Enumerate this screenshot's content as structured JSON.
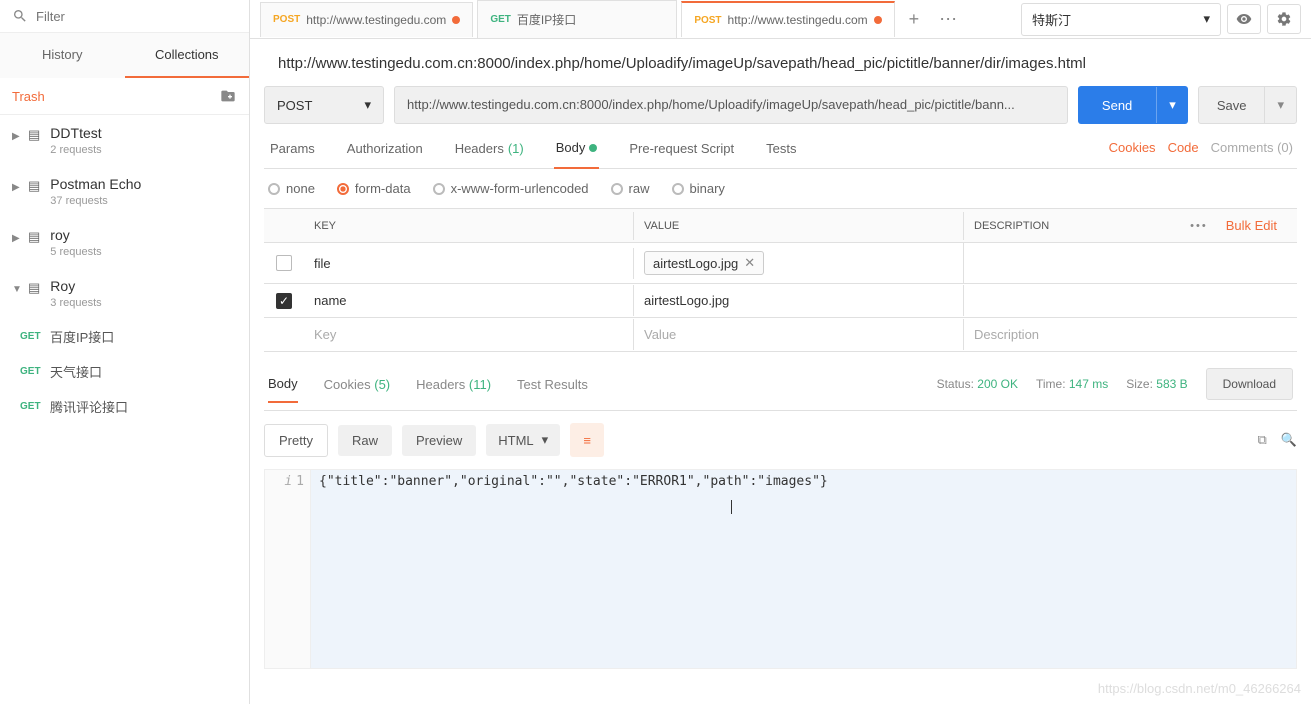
{
  "sidebar": {
    "filter_placeholder": "Filter",
    "tabs": {
      "history": "History",
      "collections": "Collections"
    },
    "trash": "Trash",
    "collections": [
      {
        "name": "DDTtest",
        "sub": "2 requests"
      },
      {
        "name": "Postman Echo",
        "sub": "37 requests"
      },
      {
        "name": "roy",
        "sub": "5 requests"
      },
      {
        "name": "Roy",
        "sub": "3 requests"
      }
    ],
    "requests": [
      {
        "method": "GET",
        "label": "百度IP接口"
      },
      {
        "method": "GET",
        "label": "天气接口"
      },
      {
        "method": "GET",
        "label": "腾讯评论接口"
      }
    ]
  },
  "topbar": {
    "environment": "特斯汀"
  },
  "tabs": [
    {
      "method": "POST",
      "title": "http://www.testingedu.com",
      "dirty": true
    },
    {
      "method": "GET",
      "title": "百度IP接口",
      "dirty": false
    },
    {
      "method": "POST",
      "title": "http://www.testingedu.com",
      "dirty": true,
      "active": true
    }
  ],
  "request": {
    "title": "http://www.testingedu.com.cn:8000/index.php/home/Uploadify/imageUp/savepath/head_pic/pictitle/banner/dir/images.html",
    "method": "POST",
    "url": "http://www.testingedu.com.cn:8000/index.php/home/Uploadify/imageUp/savepath/head_pic/pictitle/bann...",
    "send": "Send",
    "save": "Save",
    "tabs": {
      "params": "Params",
      "auth": "Authorization",
      "headers": "Headers",
      "headers_count": "(1)",
      "body": "Body",
      "pre": "Pre-request Script",
      "tests": "Tests"
    },
    "links": {
      "cookies": "Cookies",
      "code": "Code",
      "comments": "Comments (0)"
    },
    "body_types": {
      "none": "none",
      "form": "form-data",
      "url": "x-www-form-urlencoded",
      "raw": "raw",
      "binary": "binary"
    },
    "table": {
      "headers": {
        "key": "KEY",
        "value": "VALUE",
        "desc": "DESCRIPTION",
        "bulk": "Bulk Edit"
      },
      "rows": [
        {
          "checked": false,
          "key": "file",
          "value_file": "airtestLogo.jpg",
          "desc": ""
        },
        {
          "checked": true,
          "key": "name",
          "value": "airtestLogo.jpg",
          "desc": ""
        }
      ],
      "placeholders": {
        "key": "Key",
        "value": "Value",
        "desc": "Description"
      }
    }
  },
  "response": {
    "tabs": {
      "body": "Body",
      "cookies": "Cookies",
      "cookies_count": "(5)",
      "headers": "Headers",
      "headers_count": "(11)",
      "tests": "Test Results"
    },
    "status_label": "Status:",
    "status_value": "200 OK",
    "time_label": "Time:",
    "time_value": "147 ms",
    "size_label": "Size:",
    "size_value": "583 B",
    "download": "Download",
    "view": {
      "pretty": "Pretty",
      "raw": "Raw",
      "preview": "Preview",
      "type": "HTML"
    },
    "body_text": "{\"title\":\"banner\",\"original\":\"\",\"state\":\"ERROR1\",\"path\":\"images\"}",
    "line_no": "1"
  },
  "chart_data": {
    "type": "table",
    "title": "Response JSON",
    "records": [
      {
        "title": "banner",
        "original": "",
        "state": "ERROR1",
        "path": "images"
      }
    ]
  },
  "watermark": "https://blog.csdn.net/m0_46266264"
}
